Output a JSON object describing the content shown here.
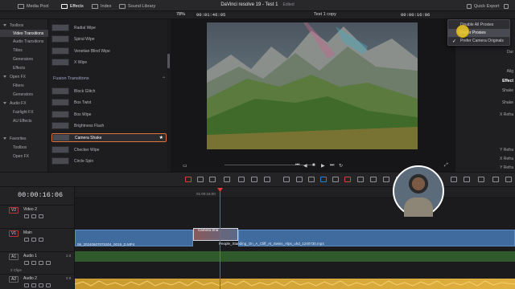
{
  "topbar": {
    "media_pool": "Media Pool",
    "effects": "Effects",
    "index": "Index",
    "sound_library": "Sound Library",
    "app_title": "DaVinci resolve 19 - Test 1",
    "edited": "Edited",
    "quick_export": "Quick Export"
  },
  "subbar": {
    "zoom": "78%",
    "source_timecode": "00:01:46:05",
    "timeline_name": "Test 1 copy",
    "record_timecode": "00:00:16:06"
  },
  "left_panel": [
    {
      "label": "Toolbox",
      "level": 0
    },
    {
      "label": "Video Transitions",
      "level": 1,
      "selected": true
    },
    {
      "label": "Audio Transitions",
      "level": 1
    },
    {
      "label": "Titles",
      "level": 1
    },
    {
      "label": "Generators",
      "level": 1
    },
    {
      "label": "Effects",
      "level": 1
    },
    {
      "label": "Open FX",
      "level": 0
    },
    {
      "label": "Filters",
      "level": 1
    },
    {
      "label": "Generators",
      "level": 1
    },
    {
      "label": "Audio FX",
      "level": 0
    },
    {
      "label": "Fairlight FX",
      "level": 1
    },
    {
      "label": "AU Effects",
      "level": 1
    },
    {
      "label": "Favorites",
      "level": 0
    },
    {
      "label": "Toolbox",
      "level": 1
    },
    {
      "label": "Open FX",
      "level": 1
    }
  ],
  "effects_list": {
    "items_top": [
      "Radial Wipe",
      "Spiral Wipe",
      "Venetian Blind Wipe",
      "X Wipe"
    ],
    "fusion_header": "Fusion Transitions",
    "fusion_items": [
      "Block Glitch",
      "Box Twist",
      "Box Wipe",
      "Brightness Flash",
      "Camera Shake",
      "Checker Wipe",
      "Circle Spin"
    ],
    "selected": "Camera Shake"
  },
  "dropdown": {
    "items": [
      "Disable All Proxies",
      "Prefer Proxies",
      "Prefer Camera Originals"
    ],
    "checked_index": 2,
    "highlighted_index": 1
  },
  "inspector": {
    "labels": [
      "Dur",
      "Alig",
      "Effect",
      "Shake",
      "Shake",
      "X Refra",
      "Y Refra",
      "X Refra",
      "Y Refra"
    ]
  },
  "timeline": {
    "timecode": "00:00:16:06",
    "ruler_timecode": "01:00:16:00",
    "tracks": [
      {
        "id": "V2",
        "name": "Video 2",
        "type": "video"
      },
      {
        "id": "V1",
        "name": "Main",
        "type": "video"
      },
      {
        "id": "A1",
        "name": "Audio 1",
        "type": "audio",
        "channels": "2.0",
        "clips": "2 Clips"
      },
      {
        "id": "A2",
        "name": "Audio 2",
        "type": "audio",
        "channels": "2.0"
      }
    ],
    "clip_left": "06_20240607075304_0019_D.MP4",
    "clip_right": "People_Standing_On_A_Cliff_At_Swiss_Alps_uhd_1240730.mp4",
    "transition_label": "Camera Sha"
  },
  "colors": {
    "accent_orange": "#e0743a",
    "playhead_red": "#e23b3b",
    "video_clip_blue": "#3f6b9e",
    "audio_green": "#2f5a2c",
    "audio_yellow": "#d8a838"
  }
}
